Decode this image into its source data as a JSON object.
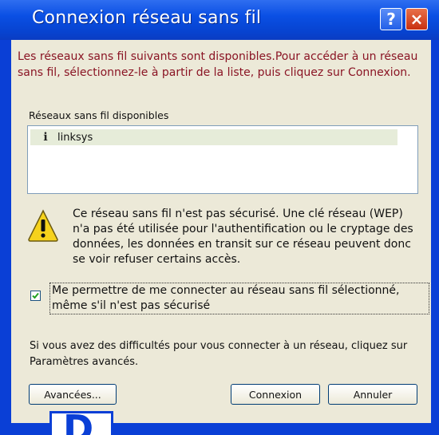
{
  "window": {
    "title": "Connexion réseau sans fil"
  },
  "titlebar": {
    "help_glyph": "?",
    "close_glyph": "×"
  },
  "intro_text": "Les réseaux sans fil suivants sont disponibles.Pour accéder à un réseau sans fil, sélectionnez-le à partir de la liste, puis cliquez sur Connexion.",
  "networks": {
    "label": "Réseaux sans fil disponibles",
    "items": [
      {
        "name": "linksys",
        "icon": "wireless-signal-icon"
      }
    ]
  },
  "warning": {
    "icon": "warning-triangle-icon",
    "text": "Ce réseau sans fil n'est pas sécurisé. Une clé réseau (WEP) n'a pas été utilisée pour l'authentification ou le cryptage des données, les données en transit sur ce réseau peuvent donc se voir refuser certains accès."
  },
  "allow_insecure": {
    "checked": true,
    "label": "Me permettre de me connecter au réseau sans fil sélectionné, même s'il n'est pas sécurisé"
  },
  "help_text": "Si vous avez des difficultés pour vous connecter à un réseau, cliquez sur Paramètres avancés.",
  "buttons": {
    "advanced": "Avancées...",
    "connect": "Connexion",
    "cancel": "Annuler"
  },
  "figure_marker": "D",
  "colors": {
    "titlebar": "#0a4fe4",
    "dialog_bg": "#ece9d8",
    "intro_text": "#8a1424",
    "close_button": "#c83010",
    "selected_row": "#e6ecd9"
  }
}
